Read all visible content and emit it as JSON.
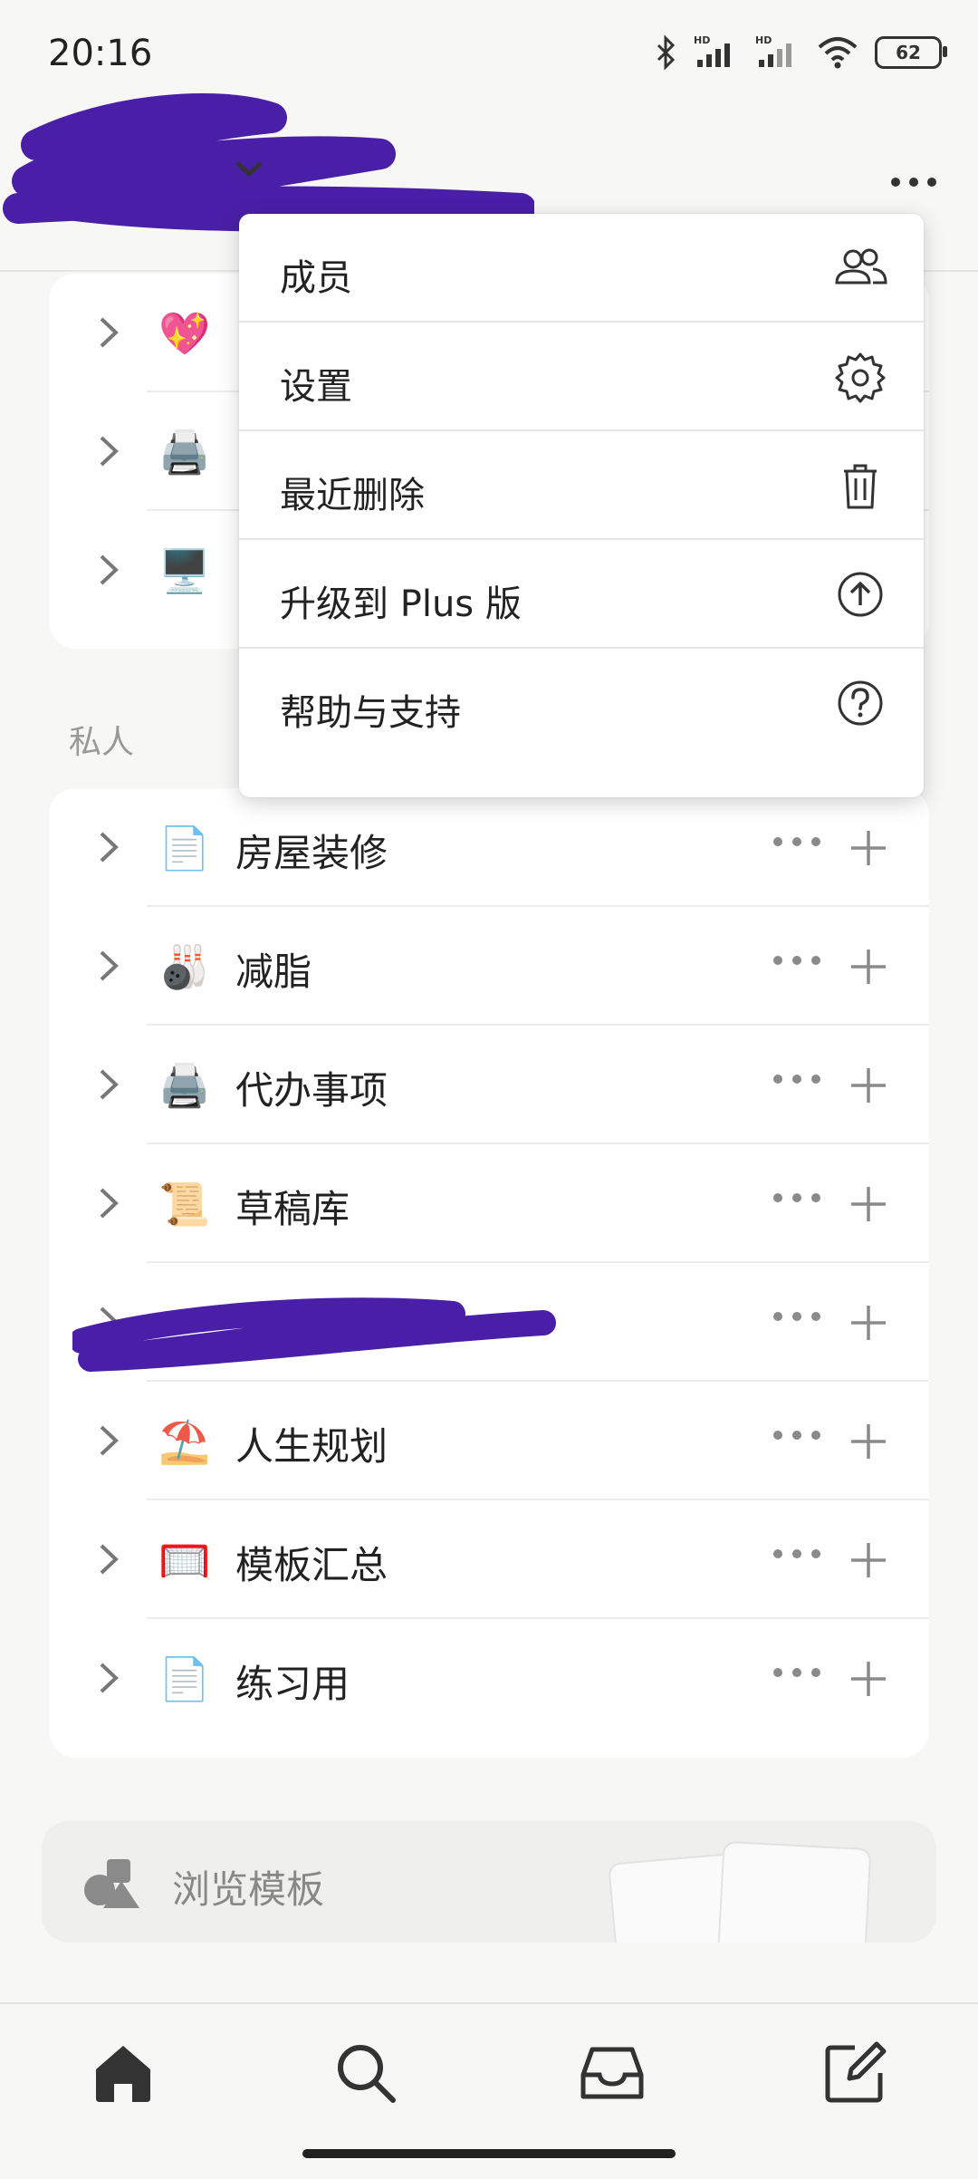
{
  "status_bar": {
    "time": "20:16",
    "battery": "62"
  },
  "workspace_rows": [
    {
      "icon": "💖"
    },
    {
      "icon": "🖨️"
    },
    {
      "icon": "🖥️"
    }
  ],
  "private_section": {
    "label": "私人",
    "items": [
      {
        "icon": "📄",
        "label": "房屋装修"
      },
      {
        "icon": "🎳",
        "label": "减脂"
      },
      {
        "icon": "🖨️",
        "label": "代办事项"
      },
      {
        "icon": "📜",
        "label": "草稿库"
      },
      {
        "icon": "",
        "label": ""
      },
      {
        "icon": "⛱️",
        "label": "人生规划"
      },
      {
        "icon": "🥅",
        "label": "模板汇总"
      },
      {
        "icon": "📄",
        "label": "练习用"
      }
    ]
  },
  "browse_templates": {
    "label": "浏览模板"
  },
  "dropdown_menu": {
    "items": [
      {
        "label": "成员",
        "icon": "people-icon"
      },
      {
        "label": "设置",
        "icon": "gear-icon"
      },
      {
        "label": "最近删除",
        "icon": "trash-icon"
      },
      {
        "label": "升级到 Plus 版",
        "icon": "upgrade-arrow-icon"
      },
      {
        "label": "帮助与支持",
        "icon": "help-icon"
      }
    ]
  },
  "bottom_nav": [
    "home-icon",
    "search-icon",
    "inbox-icon",
    "compose-icon"
  ],
  "colors": {
    "background": "#f7f7f5",
    "card": "#ffffff",
    "redaction": "#4a1fa8",
    "muted": "#8a8a8a"
  }
}
